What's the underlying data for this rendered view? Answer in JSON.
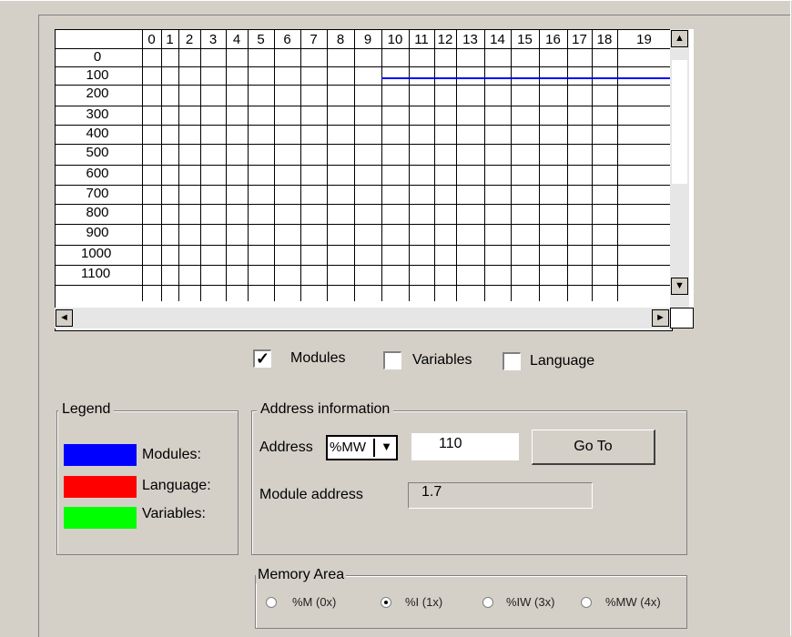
{
  "grid": {
    "columns": [
      "0",
      "1",
      "2",
      "3",
      "4",
      "5",
      "6",
      "7",
      "8",
      "9",
      "10",
      "11",
      "12",
      "13",
      "14",
      "15",
      "16",
      "17",
      "18",
      "19"
    ],
    "rows": [
      "0",
      "100",
      "200",
      "300",
      "400",
      "500",
      "600",
      "700",
      "800",
      "900",
      "1000",
      "1100"
    ]
  },
  "scroll": {
    "up": "▲",
    "down": "▼",
    "left": "◄",
    "right": "►"
  },
  "checkboxes": [
    {
      "label": "Modules",
      "checked": true,
      "mark": "✓"
    },
    {
      "label": "Variables",
      "checked": false,
      "mark": ""
    },
    {
      "label": "Language",
      "checked": false,
      "mark": ""
    }
  ],
  "legend": {
    "title": "Legend",
    "items": [
      {
        "label": "Modules:",
        "color": "#0000ff"
      },
      {
        "label": "Language:",
        "color": "#ff0000"
      },
      {
        "label": "Variables:",
        "color": "#00ff00"
      }
    ]
  },
  "address_info": {
    "title": "Address information",
    "address_label": "Address",
    "address_type": "%MW",
    "dropdown_arrow": "▼",
    "address_value": "110",
    "goto_label": "Go To",
    "module_address_label": "Module address",
    "module_address_value": "1.7"
  },
  "memory_area": {
    "title": "Memory Area",
    "options": [
      {
        "label": "%M (0x)",
        "selected": false
      },
      {
        "label": "%I (1x)",
        "selected": true
      },
      {
        "label": "%IW (3x)",
        "selected": false
      },
      {
        "label": "%MW (4x)",
        "selected": false
      }
    ]
  }
}
